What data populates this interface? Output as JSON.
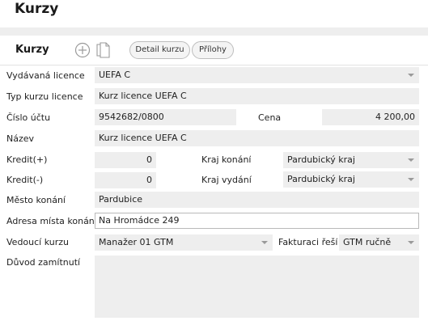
{
  "window": {
    "title": "Kurzy"
  },
  "toolbar": {
    "title": "Kurzy",
    "add_icon": "plus-circle-icon",
    "copy_icon": "copy-icon",
    "detail_label": "Detail kurzu",
    "attachments_label": "Přílohy"
  },
  "form": {
    "license_label": "Vydávaná licence",
    "license_value": "UEFA C",
    "course_type_label": "Typ kurzu licence",
    "course_type_value": "Kurz licence UEFA C",
    "account_label": "Číslo účtu",
    "account_value": "9542682/0800",
    "price_label": "Cena",
    "price_value": "4 200,00",
    "name_label": "Název",
    "name_value": "Kurz licence UEFA C",
    "credit_plus_label": "Kredit(+)",
    "credit_plus_value": "0",
    "region_held_label": "Kraj konání",
    "region_held_value": "Pardubický kraj",
    "credit_minus_label": "Kredit(-)",
    "credit_minus_value": "0",
    "region_issued_label": "Kraj vydání",
    "region_issued_value": "Pardubický kraj",
    "city_label": "Město konání",
    "city_value": "Pardubice",
    "address_label": "Adresa místa konání",
    "address_value": "Na Hromádce 249",
    "leader_label": "Vedoucí kurzu",
    "leader_value": "Manažer 01 GTM",
    "invoicing_label": "Fakturaci řeší",
    "invoicing_value": "GTM ručně",
    "rejection_label": "Důvod zamítnutí",
    "rejection_value": ""
  }
}
